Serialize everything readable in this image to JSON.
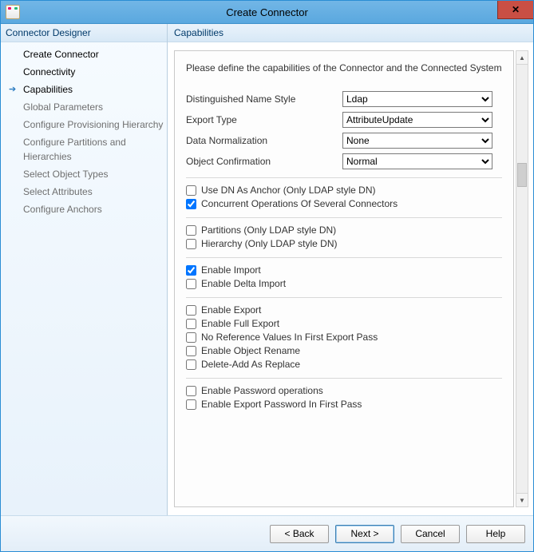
{
  "window": {
    "title": "Create Connector"
  },
  "sidebar": {
    "header": "Connector Designer",
    "items": [
      {
        "label": "Create Connector",
        "active": false,
        "child": false
      },
      {
        "label": "Connectivity",
        "active": false,
        "child": false
      },
      {
        "label": "Capabilities",
        "active": true,
        "child": false
      },
      {
        "label": "Global Parameters",
        "active": false,
        "child": true
      },
      {
        "label": "Configure Provisioning Hierarchy",
        "active": false,
        "child": true
      },
      {
        "label": "Configure Partitions and Hierarchies",
        "active": false,
        "child": true
      },
      {
        "label": "Select Object Types",
        "active": false,
        "child": true
      },
      {
        "label": "Select Attributes",
        "active": false,
        "child": true
      },
      {
        "label": "Configure Anchors",
        "active": false,
        "child": true
      }
    ]
  },
  "content": {
    "header": "Capabilities",
    "instruction": "Please define the capabilities of the Connector and the Connected System",
    "fields": {
      "distinguished_name_style": {
        "label": "Distinguished Name Style",
        "value": "Ldap"
      },
      "export_type": {
        "label": "Export Type",
        "value": "AttributeUpdate"
      },
      "data_normalization": {
        "label": "Data Normalization",
        "value": "None"
      },
      "object_confirmation": {
        "label": "Object Confirmation",
        "value": "Normal"
      }
    },
    "checks": {
      "use_dn_as_anchor": {
        "label": "Use DN As Anchor (Only LDAP style DN)",
        "checked": false
      },
      "concurrent_ops": {
        "label": "Concurrent Operations Of Several Connectors",
        "checked": true
      },
      "partitions": {
        "label": "Partitions (Only LDAP style DN)",
        "checked": false
      },
      "hierarchy": {
        "label": "Hierarchy (Only LDAP style DN)",
        "checked": false
      },
      "enable_import": {
        "label": "Enable Import",
        "checked": true
      },
      "enable_delta_import": {
        "label": "Enable Delta Import",
        "checked": false
      },
      "enable_export": {
        "label": "Enable Export",
        "checked": false
      },
      "enable_full_export": {
        "label": "Enable Full Export",
        "checked": false
      },
      "no_ref_first_export": {
        "label": "No Reference Values In First Export Pass",
        "checked": false
      },
      "enable_object_rename": {
        "label": "Enable Object Rename",
        "checked": false
      },
      "delete_add_as_replace": {
        "label": "Delete-Add As Replace",
        "checked": false
      },
      "enable_password_ops": {
        "label": "Enable Password operations",
        "checked": false
      },
      "enable_export_pw_first": {
        "label": "Enable Export Password In First Pass",
        "checked": false
      }
    }
  },
  "footer": {
    "back": "<  Back",
    "next": "Next  >",
    "cancel": "Cancel",
    "help": "Help"
  }
}
